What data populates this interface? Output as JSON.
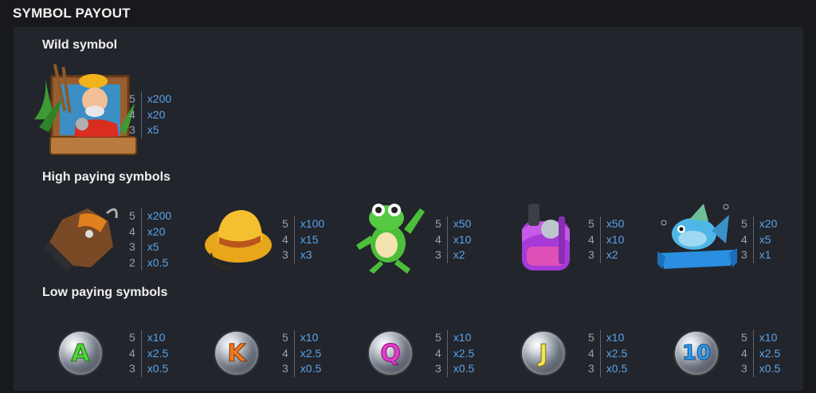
{
  "header": {
    "title": "SYMBOL PAYOUT"
  },
  "sections": {
    "wild": "Wild symbol",
    "high": "High paying symbols",
    "low": "Low paying symbols"
  },
  "wild_symbol": {
    "icon": "fisherman-icon",
    "payouts": [
      {
        "count": "5",
        "mult": "x200"
      },
      {
        "count": "4",
        "mult": "x20"
      },
      {
        "count": "3",
        "mult": "x5"
      }
    ]
  },
  "high_symbols": [
    {
      "icon": "boot-icon",
      "payouts": [
        {
          "count": "5",
          "mult": "x200"
        },
        {
          "count": "4",
          "mult": "x20"
        },
        {
          "count": "3",
          "mult": "x5"
        },
        {
          "count": "2",
          "mult": "x0.5"
        }
      ]
    },
    {
      "icon": "hat-icon",
      "payouts": [
        {
          "count": "5",
          "mult": "x100"
        },
        {
          "count": "4",
          "mult": "x15"
        },
        {
          "count": "3",
          "mult": "x3"
        }
      ]
    },
    {
      "icon": "frog-icon",
      "payouts": [
        {
          "count": "5",
          "mult": "x50"
        },
        {
          "count": "4",
          "mult": "x10"
        },
        {
          "count": "3",
          "mult": "x2"
        }
      ]
    },
    {
      "icon": "backpack-icon",
      "payouts": [
        {
          "count": "5",
          "mult": "x50"
        },
        {
          "count": "4",
          "mult": "x10"
        },
        {
          "count": "3",
          "mult": "x2"
        }
      ]
    },
    {
      "icon": "fish-icon",
      "payouts": [
        {
          "count": "5",
          "mult": "x20"
        },
        {
          "count": "4",
          "mult": "x5"
        },
        {
          "count": "3",
          "mult": "x1"
        }
      ]
    }
  ],
  "low_symbols": [
    {
      "letter": "A",
      "color": "#4fd63c",
      "payouts": [
        {
          "count": "5",
          "mult": "x10"
        },
        {
          "count": "4",
          "mult": "x2.5"
        },
        {
          "count": "3",
          "mult": "x0.5"
        }
      ]
    },
    {
      "letter": "K",
      "color": "#f07a22",
      "payouts": [
        {
          "count": "5",
          "mult": "x10"
        },
        {
          "count": "4",
          "mult": "x2.5"
        },
        {
          "count": "3",
          "mult": "x0.5"
        }
      ]
    },
    {
      "letter": "Q",
      "color": "#e83ad0",
      "payouts": [
        {
          "count": "5",
          "mult": "x10"
        },
        {
          "count": "4",
          "mult": "x2.5"
        },
        {
          "count": "3",
          "mult": "x0.5"
        }
      ]
    },
    {
      "letter": "J",
      "color": "#f2e55a",
      "payouts": [
        {
          "count": "5",
          "mult": "x10"
        },
        {
          "count": "4",
          "mult": "x2.5"
        },
        {
          "count": "3",
          "mult": "x0.5"
        }
      ]
    },
    {
      "letter": "10",
      "color": "#2f9df0",
      "payouts": [
        {
          "count": "5",
          "mult": "x10"
        },
        {
          "count": "4",
          "mult": "x2.5"
        },
        {
          "count": "3",
          "mult": "x0.5"
        }
      ]
    }
  ]
}
